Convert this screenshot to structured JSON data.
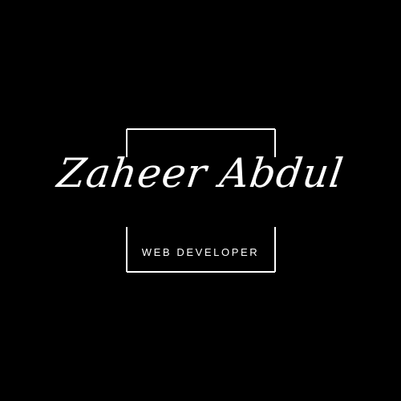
{
  "logo": {
    "name": "Zaheer Abdul",
    "tagline": "WEB DEVELOPER"
  },
  "colors": {
    "background": "#000000",
    "foreground": "#ffffff"
  }
}
